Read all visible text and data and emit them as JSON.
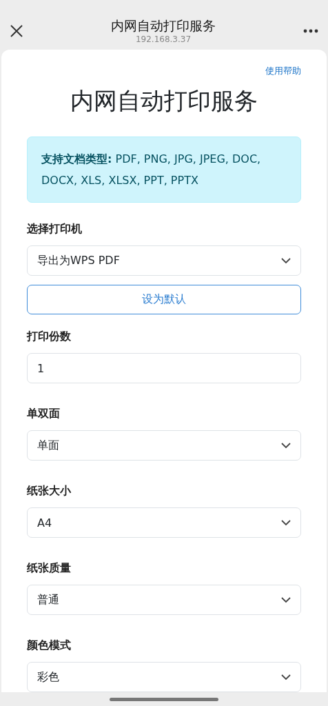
{
  "nav_bar": {
    "title": "内网自动打印服务",
    "url": "192.168.3.37"
  },
  "help_link": "使用帮助",
  "heading": "内网自动打印服务",
  "info_box": "**支持文档类型:** PDF, PNG, JPG, JPEG, DOC, DOCX, XLS, XLSX, PPT, PPTX",
  "fields": [
    {
      "kind": "select",
      "label": "选择打印机",
      "value": "导出为WPS PDF",
      "button": "设为默认"
    },
    {
      "kind": "input",
      "label": "打印份数",
      "value": "1"
    },
    {
      "kind": "select",
      "label": "单双面",
      "value": "单面"
    },
    {
      "kind": "select",
      "label": "纸张大小",
      "value": "A4"
    },
    {
      "kind": "select",
      "label": "纸张质量",
      "value": "普通"
    },
    {
      "kind": "select",
      "label": "颜色模式",
      "value": "彩色"
    }
  ]
}
